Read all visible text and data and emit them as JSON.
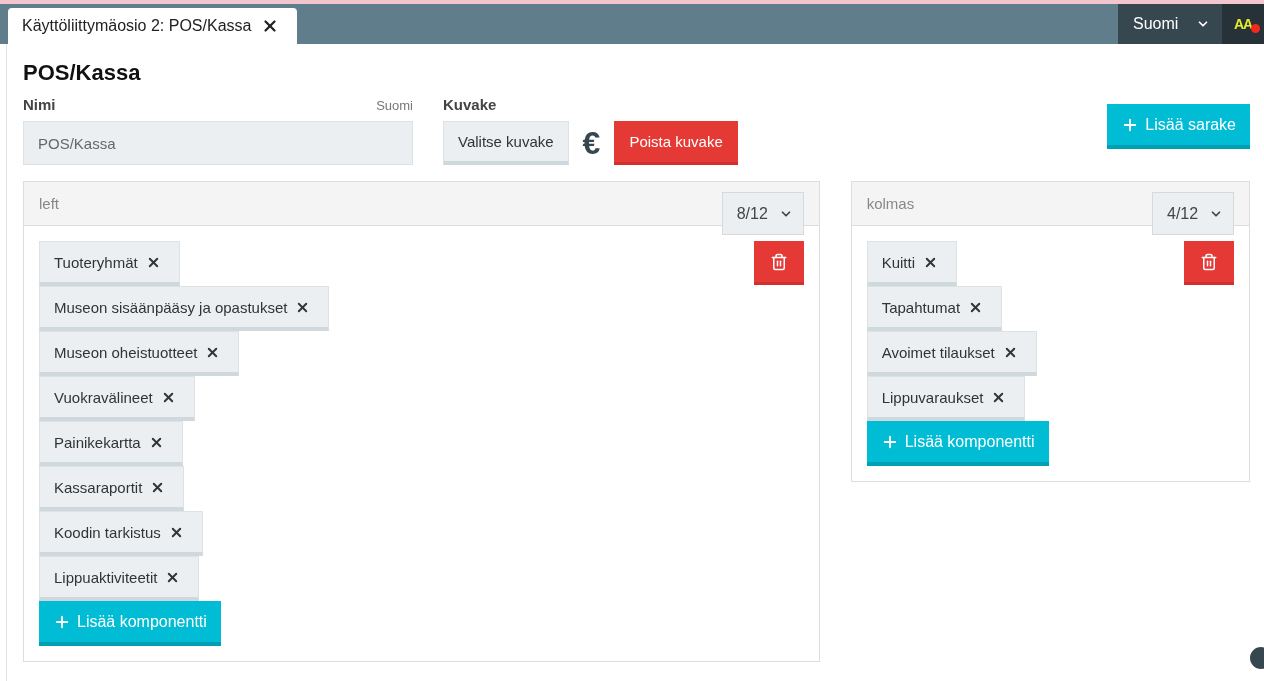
{
  "tab": {
    "label": "Käyttöliittymäosio 2: POS/Kassa",
    "closable": true
  },
  "language": {
    "value": "Suomi"
  },
  "user_badge": {
    "text": "AA",
    "notification": true
  },
  "title": "POS/Kassa",
  "name_field": {
    "label": "Nimi",
    "language": "Suomi",
    "value": "POS/Kassa"
  },
  "icon_field": {
    "label": "Kuvake",
    "choose_button": "Valitse kuvake",
    "preview": "€",
    "remove_button": "Poista kuvake"
  },
  "add_column_button": "Lisää sarake",
  "columns": [
    {
      "title": "left",
      "width": "8/12",
      "components": [
        "Tuoteryhmät",
        "Museon sisäänpääsy ja opastukset",
        "Museon oheistuotteet",
        "Vuokravälineet",
        "Painikekartta",
        "Kassaraportit",
        "Koodin tarkistus",
        "Lippuaktiviteetit"
      ],
      "add_button": "Lisää komponentti"
    },
    {
      "title": "kolmas",
      "width": "4/12",
      "components": [
        "Kuitti",
        "Tapahtumat",
        "Avoimet tilaukset",
        "Lippuvaraukset"
      ],
      "add_button": "Lisää komponentti"
    }
  ]
}
